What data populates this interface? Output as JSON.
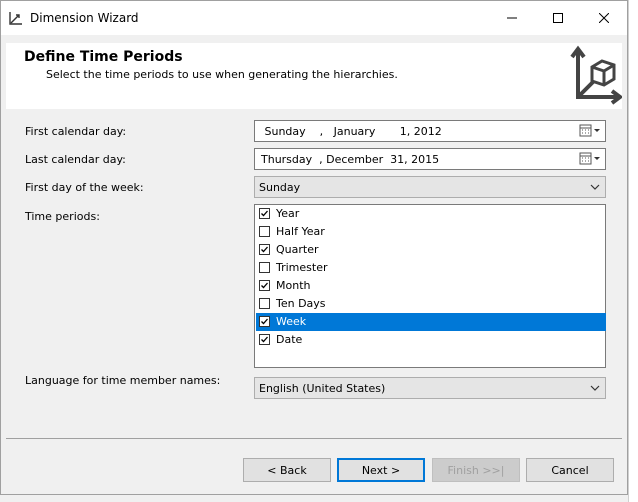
{
  "window": {
    "title": "Dimension Wizard"
  },
  "header": {
    "title": "Define Time Periods",
    "subtitle": "Select the time periods to use when generating the hierarchies."
  },
  "form": {
    "first_day_label": "First calendar day:",
    "first_day_value": " Sunday    ,   January       1, 2012",
    "last_day_label": "Last calendar day:",
    "last_day_value": "Thursday  , December  31, 2015",
    "first_dow_label": "First day of the week:",
    "first_dow_value": "Sunday",
    "time_periods_label": "Time periods:",
    "time_periods": [
      {
        "label": "Year",
        "checked": true,
        "selected": false
      },
      {
        "label": "Half Year",
        "checked": false,
        "selected": false
      },
      {
        "label": "Quarter",
        "checked": true,
        "selected": false
      },
      {
        "label": "Trimester",
        "checked": false,
        "selected": false
      },
      {
        "label": "Month",
        "checked": true,
        "selected": false
      },
      {
        "label": "Ten Days",
        "checked": false,
        "selected": false
      },
      {
        "label": "Week",
        "checked": true,
        "selected": true
      },
      {
        "label": "Date",
        "checked": true,
        "selected": false
      }
    ],
    "language_label": "Language for time member names:",
    "language_value": "English (United States)"
  },
  "buttons": {
    "back": "< Back",
    "next": "Next >",
    "finish": "Finish >>|",
    "cancel": "Cancel"
  },
  "colors": {
    "selection": "#0078d7",
    "background": "#f0f0f0"
  }
}
